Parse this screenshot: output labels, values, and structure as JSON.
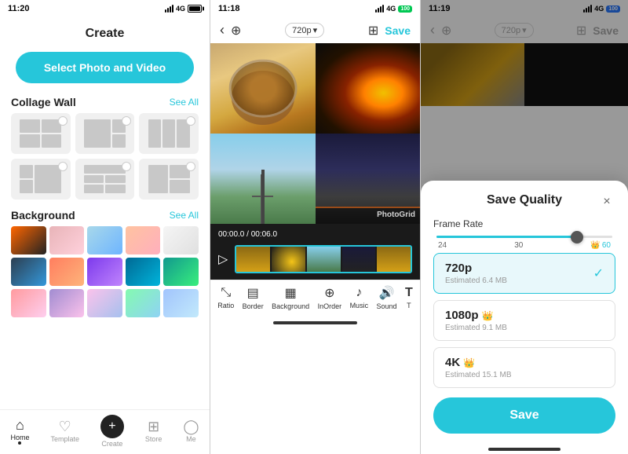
{
  "panels": {
    "panel1": {
      "status": {
        "time": "11:20",
        "battery_level": "100"
      },
      "title": "Create",
      "select_btn": "Select Photo and Video",
      "collage_section": {
        "label": "Collage Wall",
        "see_all": "See All"
      },
      "background_section": {
        "label": "Background",
        "see_all": "See All"
      },
      "nav": {
        "home": "Home",
        "template": "Template",
        "create": "Create",
        "store": "Store",
        "me": "Me"
      }
    },
    "panel2": {
      "status": {
        "time": "11:18",
        "network": "4G",
        "battery": "100"
      },
      "resolution": "720p",
      "save_label": "Save",
      "timeline_time": "00:00.0 / 00:06.0",
      "watermark": "PhotoGrid",
      "toolbar": {
        "ratio": "Ratio",
        "border": "Border",
        "background": "Background",
        "inorder": "InOrder",
        "music": "Music",
        "sound": "Sound",
        "t": "T"
      }
    },
    "panel3": {
      "status": {
        "time": "11:19",
        "network": "4G",
        "battery": "100"
      },
      "resolution": "720p",
      "save_label": "Save",
      "sheet": {
        "title": "Save Quality",
        "close_icon": "×",
        "frame_rate_label": "Frame Rate",
        "slider_min": "24",
        "slider_mid": "30",
        "slider_max": "60",
        "options": [
          {
            "resolution": "720p",
            "estimated": "Estimated 6.4 MB",
            "selected": true,
            "premium": false
          },
          {
            "resolution": "1080p",
            "estimated": "Estimated 9.1 MB",
            "selected": false,
            "premium": true
          },
          {
            "resolution": "4K",
            "estimated": "Estimated 15.1 MB",
            "selected": false,
            "premium": true
          }
        ],
        "save_btn": "Save"
      }
    }
  }
}
